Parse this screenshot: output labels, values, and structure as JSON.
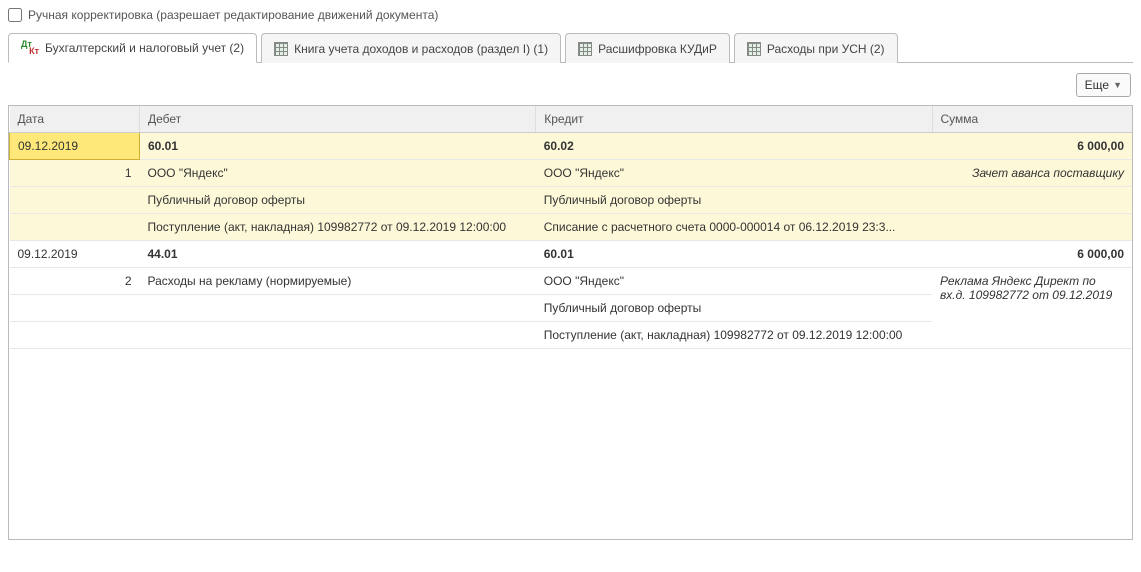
{
  "checkbox": {
    "label": "Ручная корректировка (разрешает редактирование движений документа)"
  },
  "tabs": [
    {
      "label": "Бухгалтерский и налоговый учет (2)"
    },
    {
      "label": "Книга учета доходов и расходов (раздел I) (1)"
    },
    {
      "label": "Расшифровка КУДиР"
    },
    {
      "label": "Расходы при УСН (2)"
    }
  ],
  "toolbar": {
    "more": "Еще"
  },
  "columns": {
    "date": "Дата",
    "debit": "Дебет",
    "credit": "Кредит",
    "sum": "Сумма"
  },
  "rows": [
    {
      "date": "09.12.2019",
      "num": "1",
      "debit_acct": "60.01",
      "credit_acct": "60.02",
      "sum": "6 000,00",
      "desc": "Зачет аванса поставщику",
      "debit_lines": [
        "ООО \"Яндекс\"",
        "Публичный договор оферты",
        "Поступление (акт, накладная) 109982772 от 09.12.2019 12:00:00"
      ],
      "credit_lines": [
        "ООО \"Яндекс\"",
        "Публичный договор оферты",
        "Списание с расчетного счета 0000-000014 от 06.12.2019 23:3..."
      ]
    },
    {
      "date": "09.12.2019",
      "num": "2",
      "debit_acct": "44.01",
      "credit_acct": "60.01",
      "sum": "6 000,00",
      "desc": "Реклама Яндекс Директ по вх.д. 109982772 от 09.12.2019",
      "debit_lines": [
        "Расходы на рекламу (нормируемые)"
      ],
      "credit_lines": [
        "ООО \"Яндекс\"",
        "Публичный договор оферты",
        "Поступление (акт, накладная) 109982772 от 09.12.2019 12:00:00"
      ]
    }
  ]
}
